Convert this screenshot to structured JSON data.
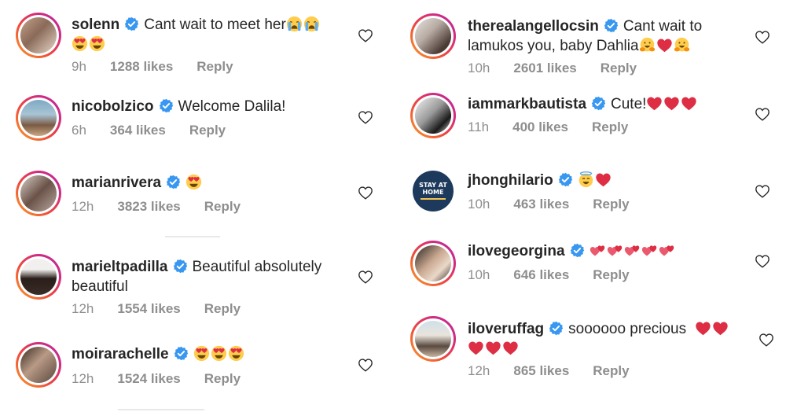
{
  "left_comments": [
    {
      "username": "solenn",
      "text": "Cant wait to meet her",
      "emoji_tail": [
        "crying-face",
        "crying-face",
        "heart-eyes-face",
        "heart-eyes-face"
      ],
      "time": "9h",
      "likes": "1288 likes",
      "reply": "Reply"
    },
    {
      "username": "nicobolzico",
      "text": "Welcome Dalila!",
      "emoji_tail": [],
      "time": "6h",
      "likes": "364 likes",
      "reply": "Reply"
    },
    {
      "username": "marianrivera",
      "text": "",
      "emoji_tail": [
        "heart-eyes-face"
      ],
      "time": "12h",
      "likes": "3823 likes",
      "reply": "Reply"
    },
    {
      "username": "marieltpadilla",
      "text": "Beautiful absolutely beautiful",
      "emoji_tail": [],
      "time": "12h",
      "likes": "1554 likes",
      "reply": "Reply"
    },
    {
      "username": "moirarachelle",
      "text": "",
      "emoji_tail": [
        "heart-eyes-face",
        "heart-eyes-face",
        "heart-eyes-face"
      ],
      "time": "12h",
      "likes": "1524 likes",
      "reply": "Reply"
    }
  ],
  "right_comments": [
    {
      "username": "therealangellocsin",
      "text": "Cant wait to lamukos you, baby Dahlia",
      "emoji_tail": [
        "hugging-face",
        "red-heart",
        "hugging-face"
      ],
      "time": "10h",
      "likes": "2601 likes",
      "reply": "Reply"
    },
    {
      "username": "iammarkbautista",
      "text": "Cute!",
      "emoji_tail": [
        "red-heart",
        "red-heart",
        "red-heart"
      ],
      "time": "11h",
      "likes": "400 likes",
      "reply": "Reply"
    },
    {
      "username": "jhonghilario",
      "text": "",
      "emoji_tail": [
        "halo-face",
        "red-heart"
      ],
      "time": "10h",
      "likes": "463 likes",
      "reply": "Reply",
      "avatar_text": [
        "STAY AT",
        "HOME"
      ]
    },
    {
      "username": "ilovegeorgina",
      "text": "",
      "emoji_tail": [
        "two-hearts",
        "two-hearts",
        "two-hearts",
        "two-hearts",
        "two-hearts"
      ],
      "time": "10h",
      "likes": "646 likes",
      "reply": "Reply"
    },
    {
      "username": "iloveruffag",
      "text": "soooooo precious",
      "emoji_tail": [
        "red-heart",
        "red-heart",
        "red-heart",
        "red-heart",
        "red-heart"
      ],
      "time": "12h",
      "likes": "865 likes",
      "reply": "Reply"
    }
  ],
  "colors": {
    "verified": "#3897f0",
    "meta": "#8e8e8e",
    "text": "#262626",
    "ring_start": "#f9a02b",
    "ring_end": "#b52aa3",
    "heart_red": "#e0245e"
  }
}
